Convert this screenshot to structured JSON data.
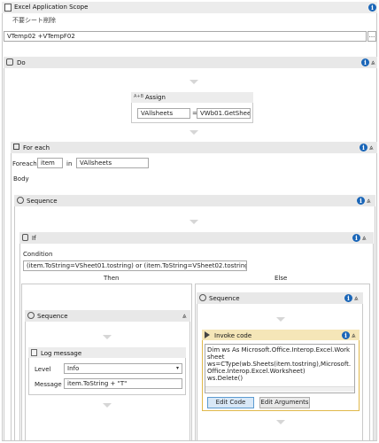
{
  "excel_scope": {
    "title": "Excel Application Scope",
    "subtitle": "不要シート削除",
    "workbook_path": "VTemp02 +VTempF02",
    "path_button": "..."
  },
  "do": {
    "title": "Do"
  },
  "assign": {
    "title": "Assign",
    "icon_label": "A+B",
    "to": "VAllsheets",
    "operator": "=",
    "value": "VWb01.GetSheets."
  },
  "for_each": {
    "title": "For each",
    "foreach_label": "Foreach",
    "item": "item",
    "in_label": "in",
    "values": "VAllsheets",
    "body_label": "Body"
  },
  "sequence_outer": {
    "title": "Sequence"
  },
  "if": {
    "title": "If",
    "condition_label": "Condition",
    "condition": "(item.ToString=VSheet01.tostring) or (item.ToString=VSheet02.tostring ) or (item.To",
    "then_label": "Then",
    "else_label": "Else"
  },
  "sequence_then": {
    "title": "Sequence"
  },
  "log_message": {
    "title": "Log message",
    "level_label": "Level",
    "level": "Info",
    "message_label": "Message",
    "message": "item.ToString + \"T\""
  },
  "sequence_else": {
    "title": "Sequence"
  },
  "invoke_code": {
    "title": "Invoke code",
    "code": "Dim ws As Microsoft.Office.Interop.Excel.Worksheet\nws=CType(wb.Sheets(item.tostring),Microsoft.Office.Interop.Excel.Worksheet)\nws.Delete()",
    "edit_code": "Edit Code",
    "edit_arguments": "Edit Arguments"
  },
  "icons": {
    "info": "i",
    "collapse": "⩓",
    "expand": "⩔"
  },
  "colors": {
    "header_bg": "#e6e6e6",
    "info_blue": "#1a66b8",
    "invoke_border": "#e0b84a",
    "invoke_header": "#f5e6b8"
  }
}
